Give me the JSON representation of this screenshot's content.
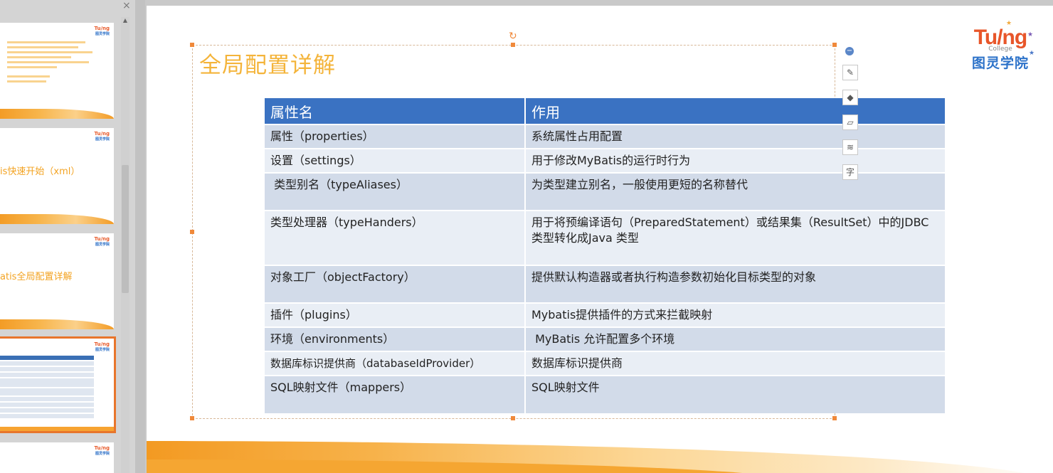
{
  "thumbnails": {
    "close": "×",
    "logo_en": "Tu/ng",
    "logo_cn": "图灵学院",
    "items": [
      {
        "title": ""
      },
      {
        "title": "is快速开始（xml）"
      },
      {
        "title": "atis全局配置详解"
      },
      {
        "title": ""
      },
      {
        "title": ""
      }
    ]
  },
  "slide": {
    "title": "全局配置详解",
    "table": {
      "headers": [
        "属性名",
        "作用"
      ],
      "rows": [
        {
          "name": "属性（properties）",
          "desc": "系统属性占用配置"
        },
        {
          "name": "设置（settings）",
          "desc": "用于修改MyBatis的运行时行为"
        },
        {
          "name": " 类型别名（typeAliases）",
          "desc": "为类型建立别名，一般使用更短的名称替代"
        },
        {
          "name": "类型处理器（typeHanders）",
          "desc": " 用于将预编译语句（PreparedStatement）或结果集（ResultSet）中的JDBC类型转化成Java 类型"
        },
        {
          "name": "对象工厂（objectFactory）",
          "desc": "提供默认构造器或者执行构造参数初始化目标类型的对象"
        },
        {
          "name": "插件（plugins）",
          "desc": "Mybatis提供插件的方式来拦截映射"
        },
        {
          "name": "环境（environments）",
          "desc": " MyBatis 允许配置多个环境"
        },
        {
          "name": "数据库标识提供商（databaseIdProvider）",
          "desc": "数据库标识提供商"
        },
        {
          "name": "SQL映射文件（mappers）",
          "desc": "SQL映射文件"
        }
      ]
    },
    "toolbar": {
      "collapse": "−",
      "edit": "✎",
      "fill": "◆",
      "outline": "▱",
      "layers": "≋",
      "text": "字"
    },
    "brand": {
      "en": "Tu/ng",
      "sub": "College",
      "cn": "图灵学院"
    },
    "rotate_glyph": "↻"
  }
}
